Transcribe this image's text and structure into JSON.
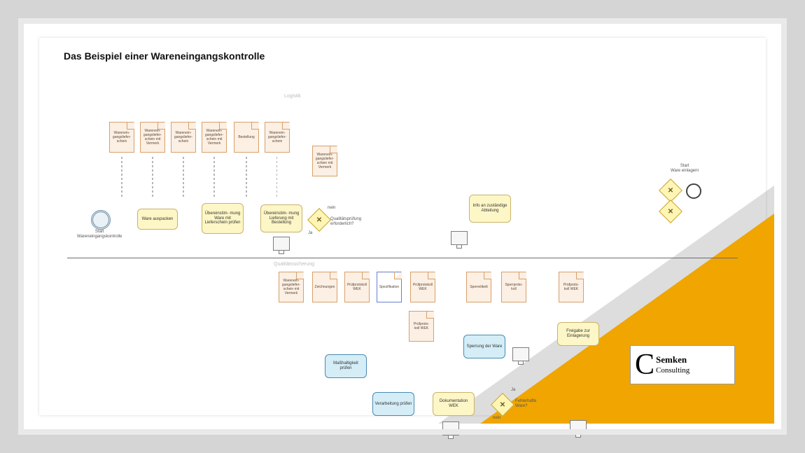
{
  "title": "Das Beispiel einer Wareneingangskontrolle",
  "lanes": {
    "top": "Logistik",
    "bottom": "Qualitätssicherung"
  },
  "events": {
    "start": "Start\nWareneingangskontrolle",
    "end": "Start\nWare einlagern"
  },
  "tasks": {
    "t1": "Ware auspacken",
    "t2": "Übereinstim-\nmung Ware mit\nLieferschein\nprüfen",
    "t3": "Übereinstim-\nmung Lieferung\nmit Bestellung",
    "t4": "Info an\nzuständige\nAbteilung",
    "t5": "Maßhaltigkeit\nprüfen",
    "t6": "Verarbeitung\nprüfen",
    "t7": "Dokumentation\nWEK",
    "t8": "Sperrung der\nWare",
    "t9": "Freigabe zur\nEinlagerung"
  },
  "gateways": {
    "g1": "Qualitätsprüfung\nerforderlich?",
    "g1_no": "nein",
    "g1_yes": "Ja",
    "g2": "Fehlerhafte\nWare?",
    "g2_yes": "Ja",
    "g2_no": "nein"
  },
  "docs": {
    "d1": "Warenein-\ngangsliefer-\nschein",
    "d2": "Warenein-\ngangsliefer-\nschein mit\nVermerk",
    "d3": "Warenein-\ngangsliefer-\nschein",
    "d4": "Warenein-\ngangsliefer-\nschein mit\nVermerk",
    "d5": "Bestellung",
    "d6": "Warenein-\ngangsliefer-\nschein",
    "d7": "Warenein-\ngangsliefer-\nschein mit\nVermerk",
    "d8": "Warenein-\ngangsliefer-\nschein mit\nVermerk",
    "d9": "Zeichnungen",
    "d10": "Prüfprotokoll\nWEK",
    "d11": "Spezifikation",
    "d12": "Prüfprotokoll\nWEK",
    "d13": "Prüfproto-\nkoll WEK",
    "d14": "Sperretikett",
    "d15": "Sperrproto-\nkoll",
    "d16": "Prüfproto-\nkoll WEK"
  },
  "logo": {
    "line1": "Semken",
    "line2": "Consulting"
  }
}
